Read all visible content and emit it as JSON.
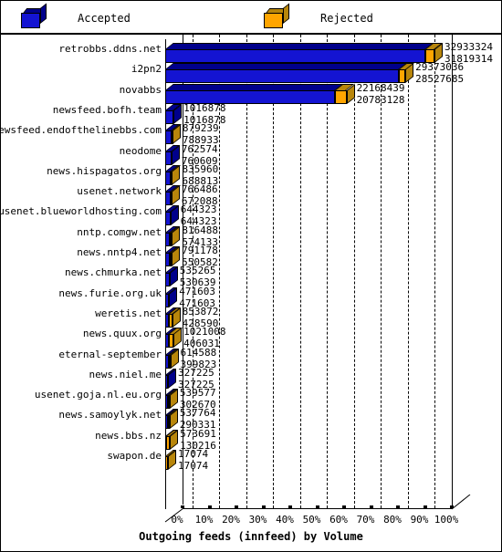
{
  "legend": {
    "accepted": {
      "label": "Accepted",
      "color": "#1414d2",
      "shade": "#00008b",
      "icon": "cube-icon"
    },
    "rejected": {
      "label": "Rejected",
      "color": "#ffa500",
      "shade": "#b8860b",
      "icon": "cube-icon"
    }
  },
  "chart_data": {
    "type": "bar",
    "orientation": "horizontal",
    "stacked": true,
    "title": "",
    "xlabel": "Outgoing feeds (innfeed) by Volume",
    "ylabel": "",
    "xlim": [
      0,
      100
    ],
    "xunit": "%",
    "grid": true,
    "legend_position": "top",
    "xticks": [
      "0%",
      "10%",
      "20%",
      "30%",
      "40%",
      "50%",
      "60%",
      "70%",
      "80%",
      "90%",
      "100%"
    ],
    "xtickvalues": [
      0,
      10,
      20,
      30,
      40,
      50,
      60,
      70,
      80,
      90,
      100
    ],
    "series": [
      {
        "name": "Accepted",
        "color": "#1414d2"
      },
      {
        "name": "Rejected",
        "color": "#ffa500"
      }
    ],
    "categories": [
      "retrobbs.ddns.net",
      "i2pn2",
      "novabbs",
      "newsfeed.bofh.team",
      "newsfeed.endofthelinebbs.com",
      "neodome",
      "news.hispagatos.org",
      "usenet.network",
      "usenet.blueworldhosting.com",
      "nntp.comgw.net",
      "news.nntp4.net",
      "news.chmurka.net",
      "news.furie.org.uk",
      "weretis.net",
      "news.quux.org",
      "eternal-september",
      "news.niel.me",
      "usenet.goja.nl.eu.org",
      "news.samoylyk.net",
      "news.bbs.nz",
      "swapon.de"
    ],
    "rows": [
      {
        "label": "retrobbs.ddns.net",
        "total": 32933324,
        "accepted": 31819314,
        "total_text": "32933324",
        "accepted_text": "31819314"
      },
      {
        "label": "i2pn2",
        "total": 29373036,
        "accepted": 28527685,
        "total_text": "29373036",
        "accepted_text": "28527685"
      },
      {
        "label": "novabbs",
        "total": 22168439,
        "accepted": 20783128,
        "total_text": "22168439",
        "accepted_text": "20783128"
      },
      {
        "label": "newsfeed.bofh.team",
        "total": 1016878,
        "accepted": 1016878,
        "total_text": "1016878",
        "accepted_text": "1016878"
      },
      {
        "label": "newsfeed.endofthelinebbs.com",
        "total": 879239,
        "accepted": 788933,
        "total_text": "879239",
        "accepted_text": "788933"
      },
      {
        "label": "neodome",
        "total": 762574,
        "accepted": 760609,
        "total_text": "762574",
        "accepted_text": "760609"
      },
      {
        "label": "news.hispagatos.org",
        "total": 835960,
        "accepted": 688813,
        "total_text": "835960",
        "accepted_text": "688813"
      },
      {
        "label": "usenet.network",
        "total": 766486,
        "accepted": 672088,
        "total_text": "766486",
        "accepted_text": "672088"
      },
      {
        "label": "usenet.blueworldhosting.com",
        "total": 644323,
        "accepted": 644323,
        "total_text": "644323",
        "accepted_text": "644323"
      },
      {
        "label": "nntp.comgw.net",
        "total": 816488,
        "accepted": 574133,
        "total_text": "816488",
        "accepted_text": "574133"
      },
      {
        "label": "news.nntp4.net",
        "total": 791178,
        "accepted": 550582,
        "total_text": "791178",
        "accepted_text": "550582"
      },
      {
        "label": "news.chmurka.net",
        "total": 535265,
        "accepted": 530639,
        "total_text": "535265",
        "accepted_text": "530639"
      },
      {
        "label": "news.furie.org.uk",
        "total": 471603,
        "accepted": 471603,
        "total_text": "471603",
        "accepted_text": "471603"
      },
      {
        "label": "weretis.net",
        "total": 853872,
        "accepted": 428590,
        "total_text": "853872",
        "accepted_text": "428590"
      },
      {
        "label": "news.quux.org",
        "total": 1021008,
        "accepted": 406031,
        "total_text": "1021008",
        "accepted_text": "406031"
      },
      {
        "label": "eternal-september",
        "total": 614588,
        "accepted": 399823,
        "total_text": "614588",
        "accepted_text": "399823"
      },
      {
        "label": "news.niel.me",
        "total": 327225,
        "accepted": 327225,
        "total_text": "327225",
        "accepted_text": "327225"
      },
      {
        "label": "usenet.goja.nl.eu.org",
        "total": 539577,
        "accepted": 302670,
        "total_text": "539577",
        "accepted_text": "302670"
      },
      {
        "label": "news.samoylyk.net",
        "total": 537764,
        "accepted": 290331,
        "total_text": "537764",
        "accepted_text": "290331"
      },
      {
        "label": "news.bbs.nz",
        "total": 573691,
        "accepted": 130216,
        "total_text": "573691",
        "accepted_text": "130216"
      },
      {
        "label": "swapon.de",
        "total": 17074,
        "accepted": 17074,
        "total_text": "17074",
        "accepted_text": "17074"
      }
    ]
  }
}
